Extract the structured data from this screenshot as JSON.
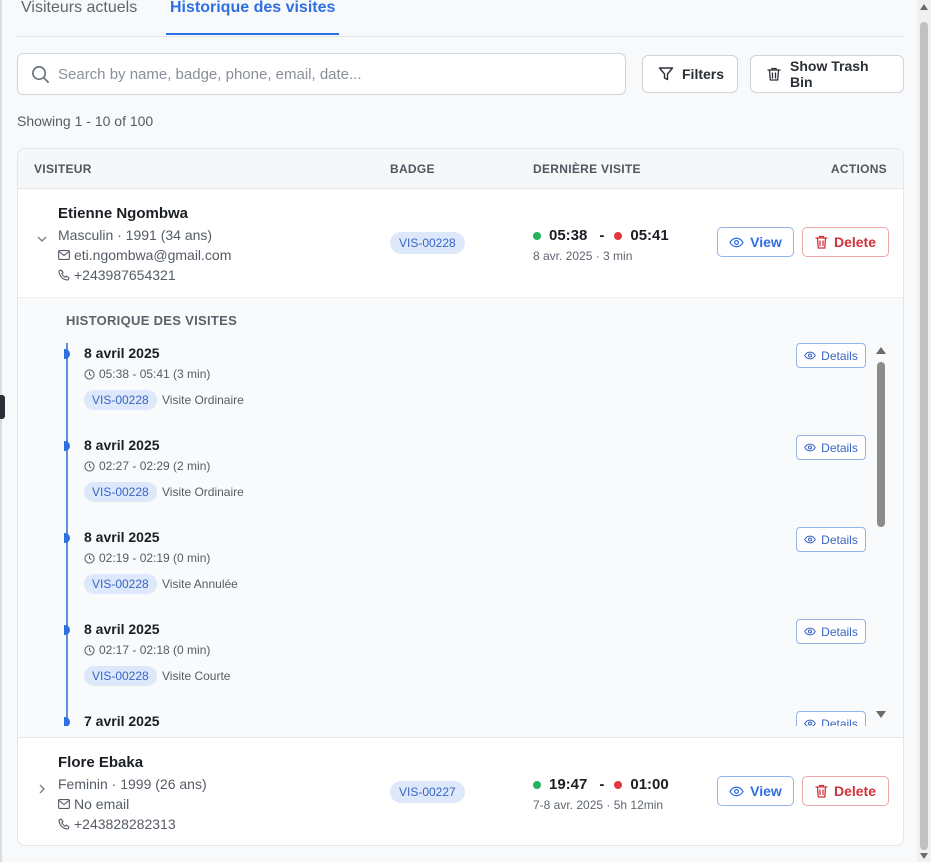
{
  "tabs": [
    {
      "label": "Visiteurs actuels",
      "active": false
    },
    {
      "label": "Historique des visites",
      "active": true
    }
  ],
  "search": {
    "placeholder": "Search by name, badge, phone, email, date..."
  },
  "toolbar": {
    "filters_label": "Filters",
    "trash_label": "Show Trash Bin"
  },
  "pagination": {
    "showing": "Showing 1 - 10 of 100"
  },
  "table": {
    "headers": {
      "visitor": "VISITEUR",
      "badge": "BADGE",
      "last_visit": "DERNIÈRE VISITE",
      "actions": "ACTIONS"
    },
    "view_label": "View",
    "delete_label": "Delete",
    "rows": [
      {
        "name": "Etienne Ngombwa",
        "meta": "Masculin · 1991 (34 ans)",
        "email": "eti.ngombwa@gmail.com",
        "phone": "+243987654321",
        "badge": "VIS-00228",
        "time_in": "05:38",
        "time_sep": "-",
        "time_out": "05:41",
        "sub": "8 avr. 2025 · 3 min",
        "expanded": true
      },
      {
        "name": "Flore Ebaka",
        "meta": "Feminin · 1999 (26 ans)",
        "email": "No email",
        "phone": "+243828282313",
        "badge": "VIS-00227",
        "time_in": "19:47",
        "time_sep": "-",
        "time_out": "01:00",
        "sub": "7-8 avr. 2025 · 5h 12min",
        "expanded": false
      }
    ]
  },
  "history": {
    "title": "HISTORIQUE DES VISITES",
    "details_label": "Details",
    "entries": [
      {
        "date": "8 avril 2025",
        "time": "05:38 - 05:41 (3 min)",
        "badge": "VIS-00228",
        "type": "Visite Ordinaire"
      },
      {
        "date": "8 avril 2025",
        "time": "02:27 - 02:29 (2 min)",
        "badge": "VIS-00228",
        "type": "Visite Ordinaire"
      },
      {
        "date": "8 avril 2025",
        "time": "02:19 - 02:19 (0 min)",
        "badge": "VIS-00228",
        "type": "Visite Annulée"
      },
      {
        "date": "8 avril 2025",
        "time": "02:17 - 02:18 (0 min)",
        "badge": "VIS-00228",
        "type": "Visite Courte"
      },
      {
        "date": "7 avril 2025"
      }
    ]
  },
  "colors": {
    "accent": "#2f6fe4",
    "danger": "#d0323a",
    "in_dot": "#22b35e",
    "out_dot": "#e0383e",
    "badge_bg": "#dde8fb"
  }
}
